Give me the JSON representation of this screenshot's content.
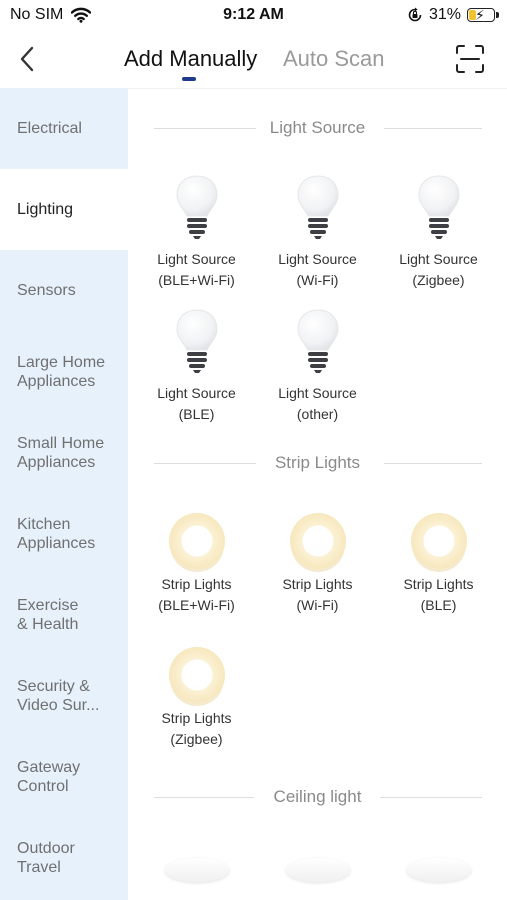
{
  "status_bar": {
    "carrier": "No SIM",
    "time": "9:12 AM",
    "battery": "31%",
    "battery_level": 0.31,
    "icons": [
      "wifi-icon",
      "orientation-lock-icon",
      "battery-charging-icon"
    ]
  },
  "header": {
    "tabs": [
      {
        "label": "Add Manually",
        "active": true
      },
      {
        "label": "Auto Scan",
        "active": false
      }
    ],
    "icons": [
      "back-chevron-icon",
      "scan-frame-icon"
    ],
    "accent": "#1f3a8a"
  },
  "sidebar": {
    "background": "#e6f1fc",
    "items": [
      {
        "line1": "Electrical",
        "line2": ""
      },
      {
        "line1": "Lighting",
        "line2": "",
        "active": true
      },
      {
        "line1": "Sensors",
        "line2": ""
      },
      {
        "line1": "Large Home",
        "line2": "Appliances"
      },
      {
        "line1": "Small Home",
        "line2": "Appliances"
      },
      {
        "line1": "Kitchen",
        "line2": "Appliances"
      },
      {
        "line1": "Exercise",
        "line2": "& Health"
      },
      {
        "line1": "Security &",
        "line2": "Video Sur..."
      },
      {
        "line1": "Gateway",
        "line2": "Control"
      },
      {
        "line1": "Outdoor",
        "line2": "Travel"
      }
    ]
  },
  "sections": [
    {
      "title": "Light Source",
      "icon": "light-bulb-icon",
      "items": [
        {
          "line1": "Light Source",
          "line2": "(BLE+Wi-Fi)"
        },
        {
          "line1": "Light Source",
          "line2": "(Wi-Fi)"
        },
        {
          "line1": "Light Source",
          "line2": "(Zigbee)"
        },
        {
          "line1": "Light Source",
          "line2": "(BLE)"
        },
        {
          "line1": "Light Source",
          "line2": "(other)"
        }
      ]
    },
    {
      "title": "Strip Lights",
      "icon": "strip-light-icon",
      "items": [
        {
          "line1": "Strip Lights",
          "line2": "(BLE+Wi-Fi)"
        },
        {
          "line1": "Strip Lights",
          "line2": "(Wi-Fi)"
        },
        {
          "line1": "Strip Lights",
          "line2": "(BLE)"
        },
        {
          "line1": "Strip Lights",
          "line2": "(Zigbee)"
        }
      ]
    },
    {
      "title": "Ceiling light",
      "icon": "ceiling-light-icon",
      "items": []
    }
  ]
}
